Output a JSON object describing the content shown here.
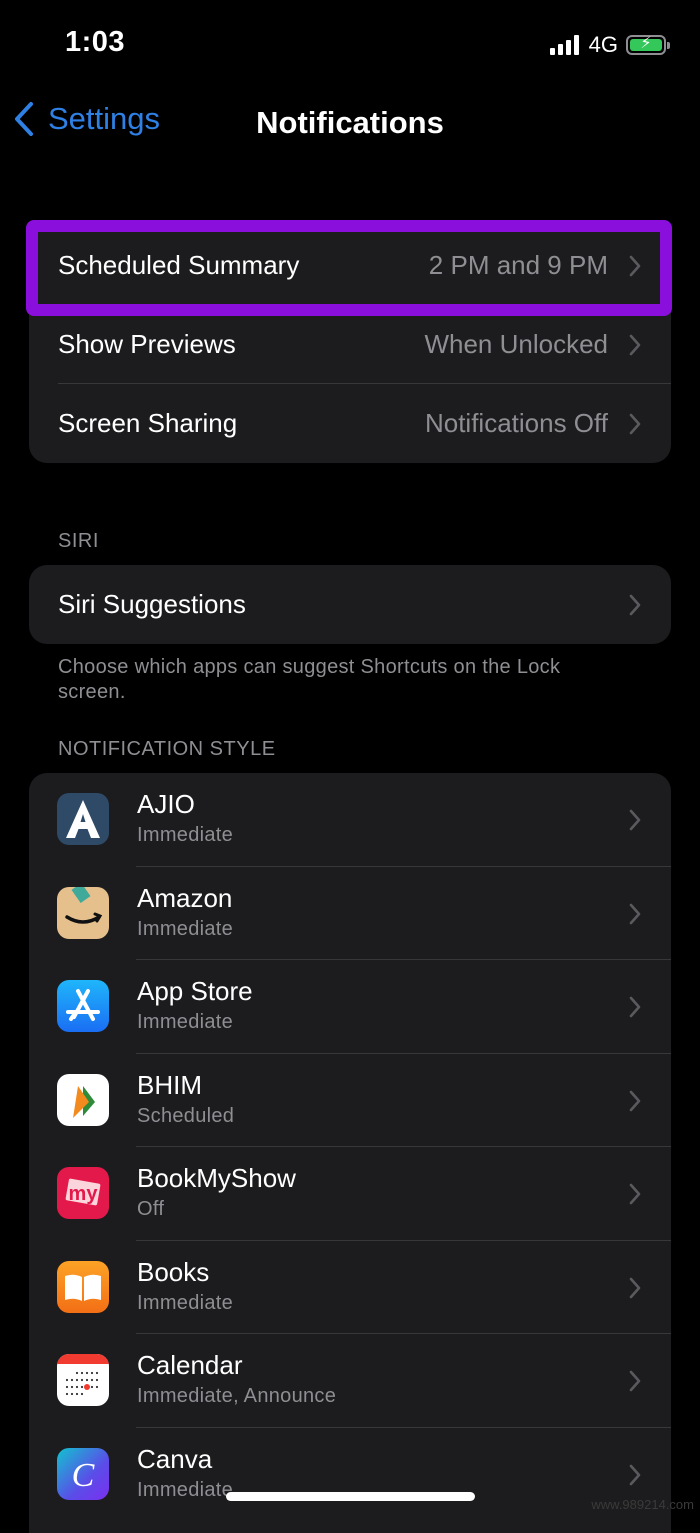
{
  "status_bar": {
    "time": "1:03",
    "network": "4G",
    "signal_bars": 4,
    "battery_state": "charging"
  },
  "nav": {
    "back_label": "Settings",
    "title": "Notifications"
  },
  "general": [
    {
      "label": "Scheduled Summary",
      "value": "2 PM and 9 PM",
      "highlighted": true
    },
    {
      "label": "Show Previews",
      "value": "When Unlocked"
    },
    {
      "label": "Screen Sharing",
      "value": "Notifications Off"
    }
  ],
  "siri": {
    "header": "SIRI",
    "row_label": "Siri Suggestions",
    "footer": "Choose which apps can suggest Shortcuts on the Lock screen."
  },
  "notification_style": {
    "header": "NOTIFICATION STYLE",
    "apps": [
      {
        "name": "AJIO",
        "status": "Immediate",
        "icon": "ajio-icon"
      },
      {
        "name": "Amazon",
        "status": "Immediate",
        "icon": "amazon-icon"
      },
      {
        "name": "App Store",
        "status": "Immediate",
        "icon": "app-store-icon"
      },
      {
        "name": "BHIM",
        "status": "Scheduled",
        "icon": "bhim-icon"
      },
      {
        "name": "BookMyShow",
        "status": "Off",
        "icon": "bookmyshow-icon"
      },
      {
        "name": "Books",
        "status": "Immediate",
        "icon": "books-icon"
      },
      {
        "name": "Calendar",
        "status": "Immediate, Announce",
        "icon": "calendar-icon"
      },
      {
        "name": "Canva",
        "status": "Immediate",
        "icon": "canva-icon"
      }
    ]
  },
  "colors": {
    "accent_blue": "#2f80e4",
    "highlight_purple": "#8a0fdc",
    "cell_bg": "#1c1c1e",
    "secondary_text": "#8e8e93",
    "battery_green": "#34c759"
  },
  "watermark": "www.989214.com"
}
